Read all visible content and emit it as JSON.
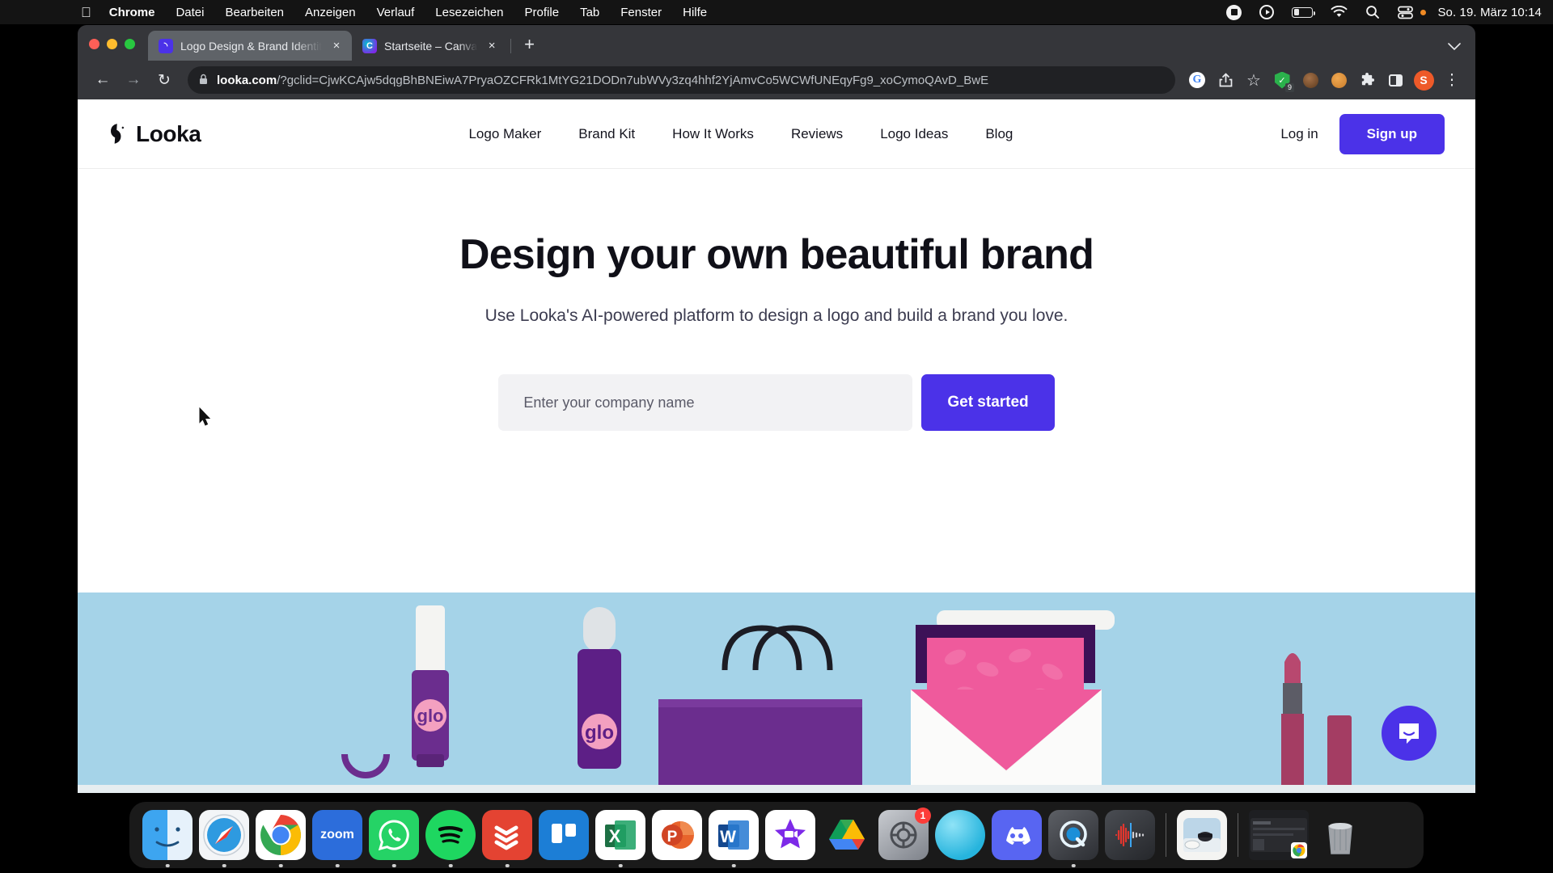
{
  "menubar": {
    "apple_icon": "apple-logo",
    "items": [
      {
        "label": "Chrome",
        "bold": true
      },
      {
        "label": "Datei",
        "bold": false
      },
      {
        "label": "Bearbeiten",
        "bold": false
      },
      {
        "label": "Anzeigen",
        "bold": false
      },
      {
        "label": "Verlauf",
        "bold": false
      },
      {
        "label": "Lesezeichen",
        "bold": false
      },
      {
        "label": "Profile",
        "bold": false
      },
      {
        "label": "Tab",
        "bold": false
      },
      {
        "label": "Fenster",
        "bold": false
      },
      {
        "label": "Hilfe",
        "bold": false
      }
    ],
    "status_icons": [
      "screen-record-icon",
      "play-icon",
      "battery-icon",
      "wifi-icon",
      "spotlight-search-icon",
      "control-center-icon"
    ],
    "clock": "So. 19. März  10:14"
  },
  "browser": {
    "tabs": [
      {
        "title": "Logo Design & Brand Identity P",
        "favicon": "looka-favicon",
        "active": true,
        "close_label": "×"
      },
      {
        "title": "Startseite – Canva",
        "favicon": "canva-favicon",
        "active": false,
        "close_label": "×"
      }
    ],
    "new_tab_label": "+",
    "tab_list_chevron": "⌄",
    "back_label": "←",
    "forward_label": "→",
    "reload_label": "↻",
    "lock_label": "🔒",
    "url_domain": "looka.com",
    "url_path": "/?gclid=CjwKCAjw5dqgBhBNEiwA7PryaOZCFRk1MtYG21DODn7ubWVy3zq4hhf2YjAmvCo5WCWfUNEqyFg9_xoCymoQAvD_BwE",
    "toolbar_icons": [
      {
        "name": "google-lens-icon",
        "glyph": "G"
      },
      {
        "name": "share-icon",
        "glyph": "⤴"
      },
      {
        "name": "bookmark-star-icon",
        "glyph": "☆"
      },
      {
        "name": "adblock-shield-icon",
        "glyph": "✓",
        "badge": "9"
      },
      {
        "name": "extension-brown-icon",
        "glyph": ""
      },
      {
        "name": "extension-orange-icon",
        "glyph": ""
      },
      {
        "name": "extensions-puzzle-icon",
        "glyph": "🧩"
      },
      {
        "name": "side-panel-icon",
        "glyph": ""
      },
      {
        "name": "profile-avatar",
        "glyph": "S"
      },
      {
        "name": "chrome-menu-icon",
        "glyph": "⋮"
      }
    ]
  },
  "site": {
    "brand_name": "Looka",
    "nav_links": [
      "Logo Maker",
      "Brand Kit",
      "How It Works",
      "Reviews",
      "Logo Ideas",
      "Blog"
    ],
    "login_label": "Log in",
    "signup_label": "Sign up",
    "hero_heading": "Design your own beautiful brand",
    "hero_subtitle": "Use Looka's AI-powered platform to design a logo and build a brand you love.",
    "input_placeholder": "Enter your company name",
    "input_value": "",
    "cta_label": "Get started",
    "hero_image_alt": "glo branded cosmetics shelf photo",
    "chat_widget": "intercom-chat-icon",
    "colors": {
      "accent": "#4b32e8",
      "hero_bg": "#a5d3e8",
      "heading": "#101018",
      "input_bg": "#f2f2f4",
      "product_purple": "#6b2d8e"
    }
  },
  "dock": {
    "items": [
      {
        "name": "finder",
        "running": true
      },
      {
        "name": "safari",
        "running": true
      },
      {
        "name": "chrome",
        "running": true
      },
      {
        "name": "zoom",
        "label": "zoom",
        "running": false
      },
      {
        "name": "whatsapp",
        "running": true
      },
      {
        "name": "spotify",
        "running": true
      },
      {
        "name": "todoist",
        "running": true
      },
      {
        "name": "trello",
        "running": false
      },
      {
        "name": "excel",
        "label": "X",
        "running": true
      },
      {
        "name": "powerpoint",
        "label": "P",
        "running": false
      },
      {
        "name": "word",
        "label": "W",
        "running": true
      },
      {
        "name": "imovie",
        "running": false
      },
      {
        "name": "google-drive",
        "running": false
      },
      {
        "name": "system-settings",
        "badge": "1",
        "running": false
      },
      {
        "name": "blue-sphere-app",
        "running": false
      },
      {
        "name": "discord",
        "running": false
      },
      {
        "name": "quicktime",
        "running": true
      },
      {
        "name": "audio-waveform-app",
        "running": false
      },
      {
        "name": "preview-photo",
        "running": false
      },
      {
        "name": "minimized-chrome-window",
        "running": false
      },
      {
        "name": "trash",
        "running": false
      }
    ]
  }
}
